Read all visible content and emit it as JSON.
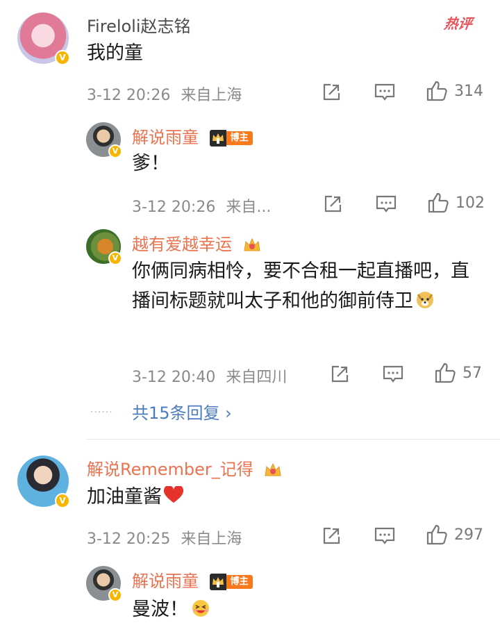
{
  "hot_badge": "热评",
  "comments": [
    {
      "user": "Fireloli赵志铭",
      "text": "我的童",
      "time": "3-12 20:26",
      "location": "来自上海",
      "likes": "314",
      "replies": [
        {
          "user": "解说雨童",
          "badge": "博主",
          "text": "爹！",
          "time": "3-12 20:26",
          "location": "来自...",
          "likes": "102"
        },
        {
          "user": "越有爱越幸运",
          "text": "你俩同病相怜，要不合租一起直播吧，直播间标题就叫太子和他的御前侍卫",
          "time": "3-12 20:40",
          "location": "来自四川",
          "likes": "57"
        }
      ],
      "more_replies": "共15条回复 ›"
    },
    {
      "user": "解说Remember_记得",
      "text": "加油童酱",
      "time": "3-12 20:25",
      "location": "来自上海",
      "likes": "297",
      "replies": [
        {
          "user": "解说雨童",
          "badge": "博主",
          "text": "曼波！"
        }
      ]
    }
  ],
  "colors": {
    "username_orange": "#eb7350",
    "link_blue": "#4a7cbf",
    "verified_gold": "#f7b500",
    "blogger_tag": "#f77a1f"
  },
  "icons": [
    "repost-icon",
    "comment-icon",
    "like-icon",
    "crown-icon",
    "verified-icon",
    "heart-icon",
    "doge-emoji",
    "laugh-emoji"
  ]
}
